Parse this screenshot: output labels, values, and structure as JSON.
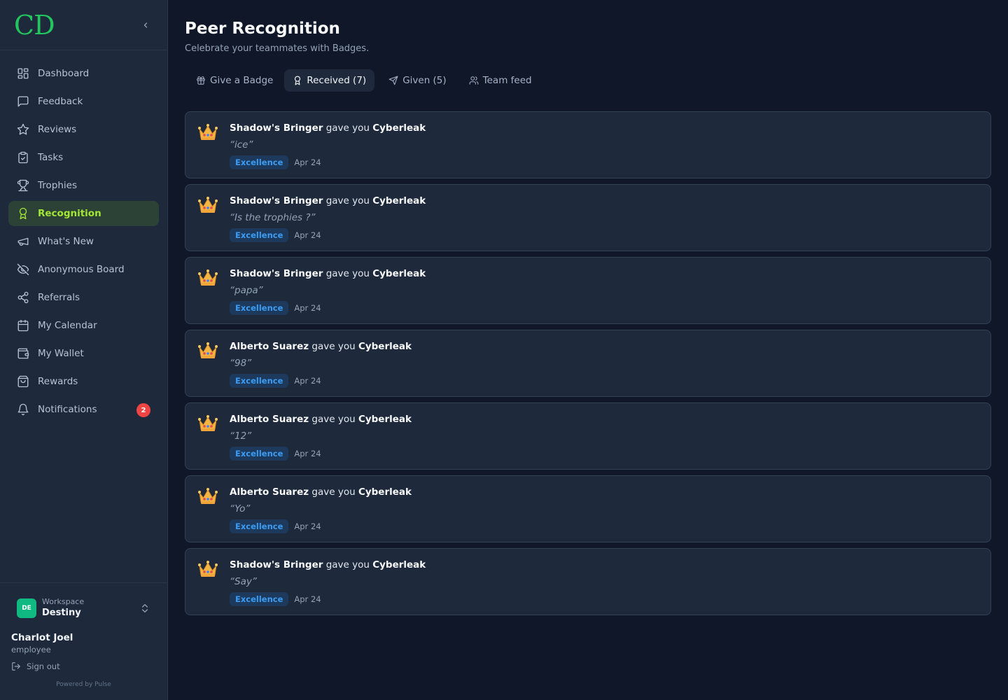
{
  "app": {
    "logo_text": "CD"
  },
  "sidebar": {
    "items": [
      {
        "label": "Dashboard",
        "icon": "dashboard-icon"
      },
      {
        "label": "Feedback",
        "icon": "message-square-icon"
      },
      {
        "label": "Reviews",
        "icon": "star-icon"
      },
      {
        "label": "Tasks",
        "icon": "clipboard-check-icon"
      },
      {
        "label": "Trophies",
        "icon": "trophy-icon"
      },
      {
        "label": "Recognition",
        "icon": "award-icon",
        "active": true
      },
      {
        "label": "What's New",
        "icon": "megaphone-icon"
      },
      {
        "label": "Anonymous Board",
        "icon": "eye-off-icon"
      },
      {
        "label": "Referrals",
        "icon": "share-icon"
      },
      {
        "label": "My Calendar",
        "icon": "calendar-icon"
      },
      {
        "label": "My Wallet",
        "icon": "wallet-icon"
      },
      {
        "label": "Rewards",
        "icon": "shopping-bag-icon"
      },
      {
        "label": "Notifications",
        "icon": "bell-icon",
        "badge": "2"
      }
    ],
    "workspace": {
      "avatar": "DE",
      "label": "Workspace",
      "name": "Destiny"
    },
    "user": {
      "name": "Charlot Joel",
      "role": "employee"
    },
    "signout_label": "Sign out",
    "powered_by": "Powered by Pulse"
  },
  "page": {
    "title": "Peer Recognition",
    "subtitle": "Celebrate your teammates with Badges."
  },
  "tabs": [
    {
      "label": "Give a Badge",
      "icon": "gift-icon"
    },
    {
      "label": "Received (7)",
      "icon": "award-icon",
      "active": true
    },
    {
      "label": "Given (5)",
      "icon": "send-icon"
    },
    {
      "label": "Team feed",
      "icon": "users-icon"
    }
  ],
  "recognitions": [
    {
      "giver": "Shadow's Bringer",
      "verb": "gave you",
      "badge": "Cyberleak",
      "message": "“ice”",
      "category": "Excellence",
      "date": "Apr 24"
    },
    {
      "giver": "Shadow's Bringer",
      "verb": "gave you",
      "badge": "Cyberleak",
      "message": "“Is the trophies ?”",
      "category": "Excellence",
      "date": "Apr 24"
    },
    {
      "giver": "Shadow's Bringer",
      "verb": "gave you",
      "badge": "Cyberleak",
      "message": "“papa”",
      "category": "Excellence",
      "date": "Apr 24"
    },
    {
      "giver": "Alberto Suarez",
      "verb": "gave you",
      "badge": "Cyberleak",
      "message": "“98”",
      "category": "Excellence",
      "date": "Apr 24"
    },
    {
      "giver": "Alberto Suarez",
      "verb": "gave you",
      "badge": "Cyberleak",
      "message": "“12”",
      "category": "Excellence",
      "date": "Apr 24"
    },
    {
      "giver": "Alberto Suarez",
      "verb": "gave you",
      "badge": "Cyberleak",
      "message": "“Yo”",
      "category": "Excellence",
      "date": "Apr 24"
    },
    {
      "giver": "Shadow's Bringer",
      "verb": "gave you",
      "badge": "Cyberleak",
      "message": "“Say”",
      "category": "Excellence",
      "date": "Apr 24"
    }
  ],
  "colors": {
    "background": "#0f1729",
    "sidebar": "#1e293b",
    "brand": "#22c55e",
    "active_text": "#a3e635",
    "tag_text": "#3b9cf6",
    "badge": "#ef4444"
  }
}
